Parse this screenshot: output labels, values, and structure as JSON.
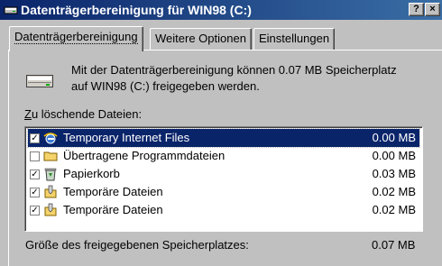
{
  "window": {
    "title": "Datenträgerbereinigung für WIN98 (C:)",
    "help_label": "?",
    "close_label": "×"
  },
  "tabs": [
    {
      "label": "Datenträgerbereinigung",
      "active": true
    },
    {
      "label": "Weitere Optionen",
      "active": false
    },
    {
      "label": "Einstellungen",
      "active": false
    }
  ],
  "description": {
    "line1": "Mit der Datenträgerbereinigung können 0.07 MB Speicherplatz",
    "line2": "auf WIN98 (C:) freigegeben werden."
  },
  "list": {
    "label_accel": "Z",
    "label_rest": "u löschende Dateien:",
    "items": [
      {
        "name": "Temporary Internet Files",
        "size": "0.00 MB",
        "checked": true,
        "icon": "internet-explorer-icon",
        "selected": true
      },
      {
        "name": "Übertragene Programmdateien",
        "size": "0.00 MB",
        "checked": false,
        "icon": "folder-icon",
        "selected": false
      },
      {
        "name": "Papierkorb",
        "size": "0.03 MB",
        "checked": true,
        "icon": "recycle-bin-icon",
        "selected": false
      },
      {
        "name": "Temporäre Dateien",
        "size": "0.02 MB",
        "checked": true,
        "icon": "temp-files-icon",
        "selected": false
      },
      {
        "name": "Temporäre Dateien",
        "size": "0.02 MB",
        "checked": true,
        "icon": "temp-files-icon",
        "selected": false
      }
    ]
  },
  "total": {
    "label": "Größe des freigegebenen Speicherplatzes:",
    "value": "0.07 MB"
  },
  "colors": {
    "titlebar": "#0a246a",
    "face": "#c0c0c0",
    "selection": "#0a246a"
  }
}
